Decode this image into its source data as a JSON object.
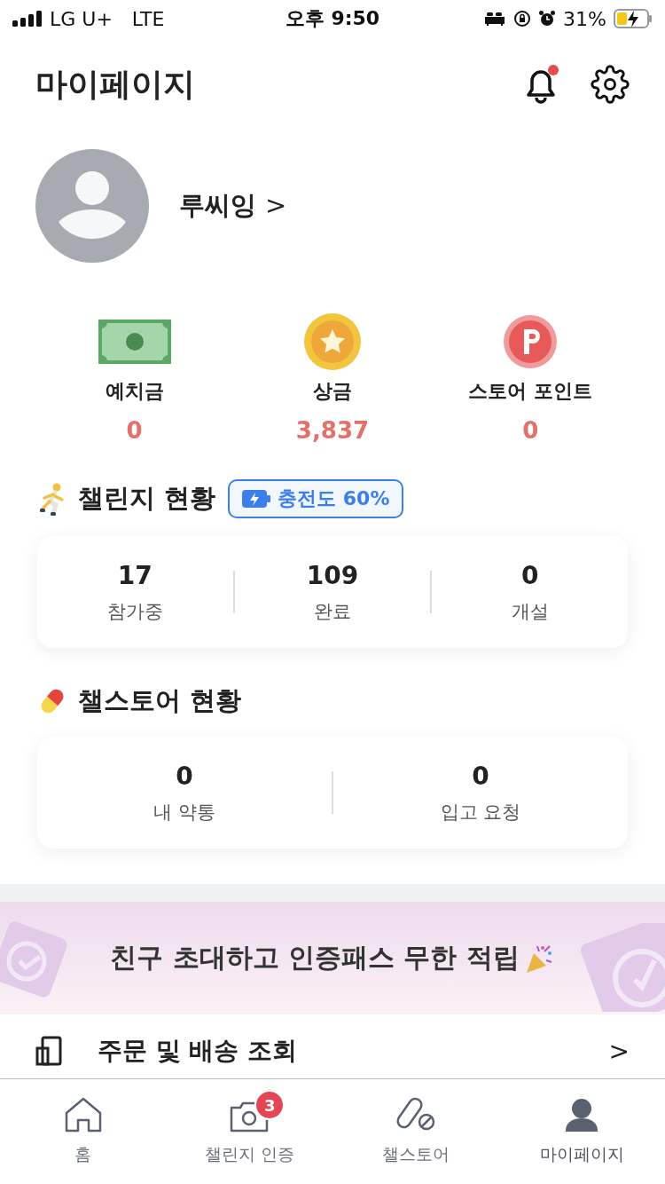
{
  "status_bar": {
    "carrier": "LG U+",
    "network": "LTE",
    "time": "오후 9:50",
    "battery": "31%"
  },
  "header": {
    "title": "마이페이지",
    "notification_dot": true
  },
  "profile": {
    "name": "루씨잉",
    "chevron": ">"
  },
  "wallet": [
    {
      "kind": "cash",
      "label": "예치금",
      "value": "0"
    },
    {
      "kind": "prize",
      "label": "상금",
      "value": "3,837"
    },
    {
      "kind": "point",
      "label": "스토어 포인트",
      "value": "0"
    }
  ],
  "challenge": {
    "title": "챌린지 현황",
    "charge": {
      "label": "충전도 60%"
    },
    "stats": [
      {
        "value": "17",
        "label": "참가중"
      },
      {
        "value": "109",
        "label": "완료"
      },
      {
        "value": "0",
        "label": "개설"
      }
    ]
  },
  "store": {
    "title": "챌스토어 현황",
    "stats": [
      {
        "value": "0",
        "label": "내 약통"
      },
      {
        "value": "0",
        "label": "입고 요청"
      }
    ]
  },
  "banner": {
    "text": "친구 초대하고 인증패스 무한 적립"
  },
  "menu": [
    {
      "label": "주문 및 배송 조회",
      "chevron": ">"
    }
  ],
  "tab_bar": [
    {
      "kind": "home",
      "label": "홈",
      "selected": false
    },
    {
      "kind": "camera",
      "label": "챌린지 인증",
      "badge": "3",
      "selected": false
    },
    {
      "kind": "pill",
      "label": "챌스토어",
      "selected": false
    },
    {
      "kind": "person",
      "label": "마이페이지",
      "selected": true
    }
  ]
}
